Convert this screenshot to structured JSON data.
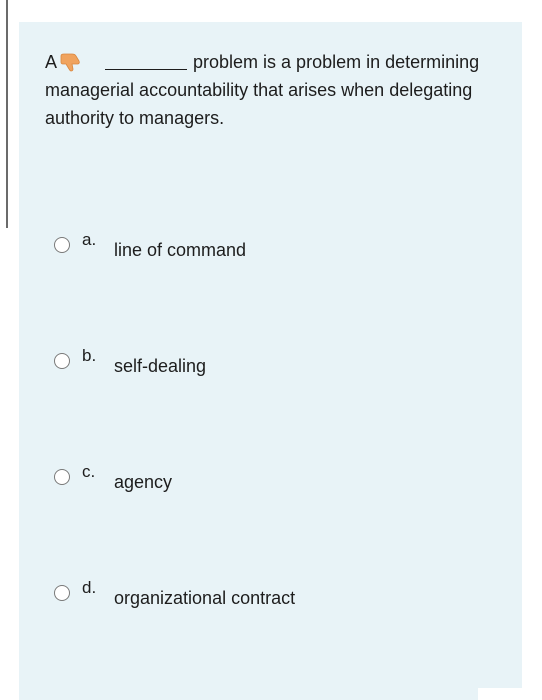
{
  "question": {
    "prefix": "A",
    "text_line1": "problem is a problem in determining",
    "text_rest": "managerial accountability that arises when delegating authority to managers."
  },
  "options": [
    {
      "letter": "a.",
      "text": "line of command"
    },
    {
      "letter": "b.",
      "text": "self-dealing"
    },
    {
      "letter": "c.",
      "text": "agency"
    },
    {
      "letter": "d.",
      "text": "organizational contract"
    }
  ],
  "colors": {
    "card_background": "#e8f3f7",
    "text": "#1d1d1d",
    "hand_icon": "#f0a35e"
  },
  "icons": {
    "hint": "thumbs-down-icon"
  }
}
